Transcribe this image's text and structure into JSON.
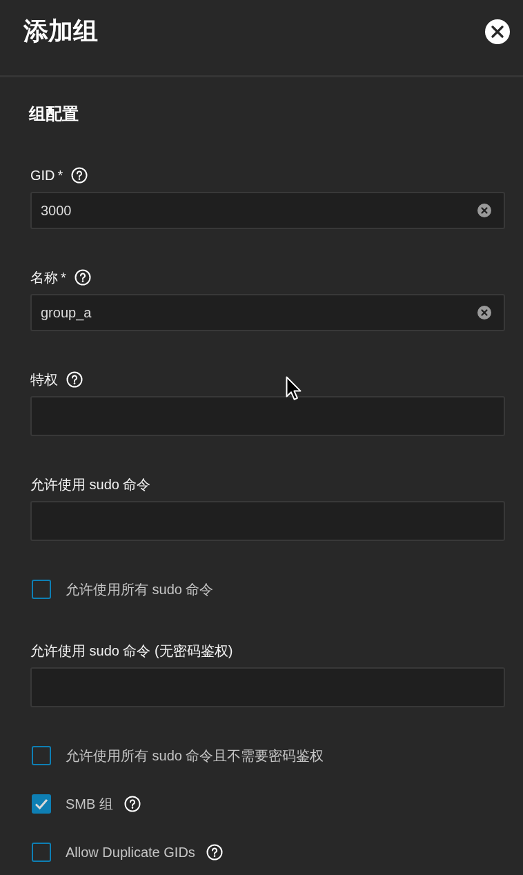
{
  "dialog": {
    "title": "添加组",
    "section_title": "组配置"
  },
  "items": [
    {
      "kind": "input",
      "label": "GID",
      "required_mark": "*",
      "help": true,
      "value": "3000",
      "clearable": true
    },
    {
      "kind": "input",
      "label": "名称",
      "required_mark": "*",
      "help": true,
      "value": "group_a",
      "clearable": true
    },
    {
      "kind": "chips",
      "label": "特权",
      "help": true
    },
    {
      "kind": "chips",
      "label": "允许使用 sudo 命令"
    },
    {
      "kind": "checkbox",
      "label": "允许使用所有 sudo 命令",
      "checked": false
    },
    {
      "kind": "chips",
      "label": "允许使用 sudo 命令 (无密码鉴权)"
    },
    {
      "kind": "checkbox",
      "label": "允许使用所有 sudo 命令且不需要密码鉴权",
      "checked": false
    },
    {
      "kind": "checkbox",
      "label": "SMB 组",
      "checked": true,
      "help": true
    },
    {
      "kind": "checkbox",
      "label": "Allow Duplicate GIDs",
      "checked": false,
      "help": true
    }
  ]
}
